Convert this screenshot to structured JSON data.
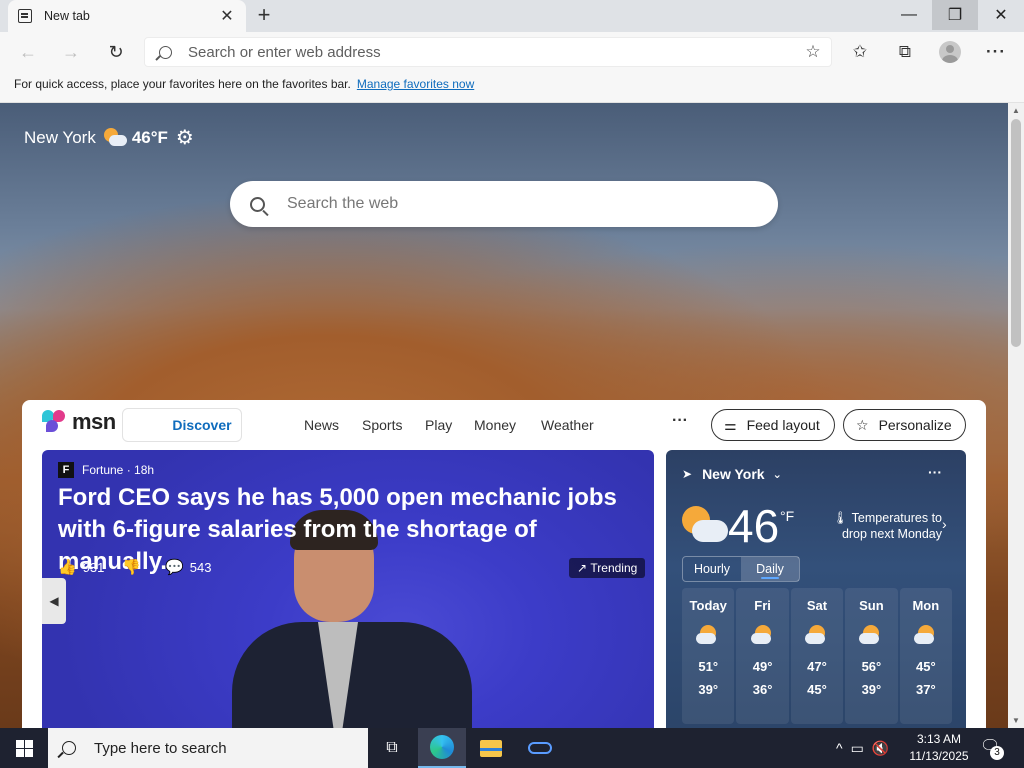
{
  "browser": {
    "tab_title": "New tab",
    "tab_close": "✕",
    "new_tab": "+",
    "window_buttons": {
      "minimize": "—",
      "maximize": "❐",
      "close": "✕"
    }
  },
  "toolbar": {
    "back": "←",
    "forward": "→",
    "reload": "↻",
    "address_placeholder": "Search or enter web address",
    "favorite_star": "☆",
    "favorites_icon": "✩",
    "collections_icon": "⧉",
    "more_icon": "···"
  },
  "favorites_bar": {
    "text": "For quick access, place your favorites here on the favorites bar.",
    "link": "Manage favorites now"
  },
  "newtab_page": {
    "weather_city": "New York",
    "weather_temp": "46°F",
    "settings_icon": "⚙",
    "search_placeholder": "Search the web"
  },
  "msn": {
    "logo_text": "msn",
    "discover": "Discover",
    "nav": [
      "News",
      "Sports",
      "Play",
      "Money",
      "Weather"
    ],
    "more": "···",
    "feed_layout": "Feed layout",
    "personalize": "Personalize"
  },
  "hero": {
    "source_logo": "F",
    "source": "Fortune · 18h",
    "title": "Ford CEO says he has 5,000 open mechanic jobs with 6-figure salaries from the shortage of manually...",
    "likes": "931",
    "comments": "543",
    "trending": "Trending",
    "prev_arrow": "◀"
  },
  "weather_card": {
    "location": "New York",
    "temp": "46",
    "unit": "°F",
    "alert": "Temperatures to drop next Monday",
    "tabs": [
      "Hourly",
      "Daily"
    ],
    "active_tab": "Daily",
    "days": [
      {
        "name": "Today",
        "hi": "51°",
        "lo": "39°"
      },
      {
        "name": "Fri",
        "hi": "49°",
        "lo": "36°"
      },
      {
        "name": "Sat",
        "hi": "47°",
        "lo": "45°"
      },
      {
        "name": "Sun",
        "hi": "56°",
        "lo": "39°"
      },
      {
        "name": "Mon",
        "hi": "45°",
        "lo": "37°"
      }
    ]
  },
  "taskbar": {
    "search_placeholder": "Type here to search",
    "task_view_icon": "⧉",
    "clock_time": "3:13 AM",
    "clock_date": "11/13/2025",
    "notification_count": "3",
    "tray_icons": [
      "^",
      "▭",
      "🔇"
    ]
  }
}
